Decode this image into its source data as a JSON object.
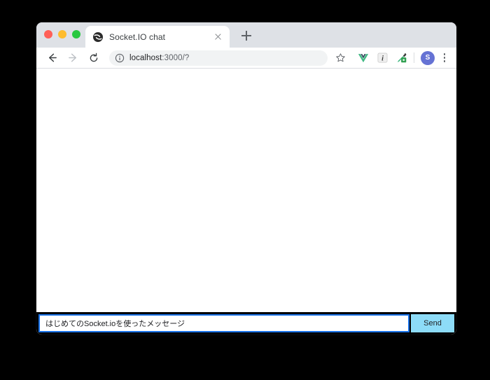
{
  "window": {
    "traffic_lights": [
      {
        "name": "close",
        "color": "#ff5f57"
      },
      {
        "name": "minimize",
        "color": "#febc2e"
      },
      {
        "name": "maximize",
        "color": "#28c840"
      }
    ]
  },
  "tabstrip": {
    "tab": {
      "title": "Socket.IO chat",
      "favicon": "socketio-globe-icon",
      "close_icon": "close-icon"
    },
    "new_tab_icon": "plus-icon"
  },
  "toolbar": {
    "back_icon": "arrow-left-icon",
    "forward_icon": "arrow-right-icon",
    "reload_icon": "reload-icon",
    "info_icon": "info-circle-icon",
    "url_host": "localhost",
    "url_rest": ":3000/?",
    "url_full": "localhost:3000/?",
    "bookmark_icon": "star-icon",
    "extensions": [
      {
        "name": "vue-devtools-icon",
        "label": "V",
        "color": "#41b883"
      },
      {
        "name": "italic-i-extension-icon",
        "label": "i",
        "color": "#6b6b6b"
      },
      {
        "name": "eyedropper-extension-icon",
        "label": "",
        "color": "#2e9e4f"
      }
    ],
    "avatar_label": "S",
    "avatar_color": "#6572d4",
    "menu_icon": "kebab-menu-icon"
  },
  "page": {
    "messages": [],
    "input_value": "はじめてのSocket.ioを使ったメッセージ",
    "input_placeholder": "",
    "send_label": "Send",
    "send_color": "#8ddcf8",
    "input_focus_color": "#1a73e8"
  }
}
